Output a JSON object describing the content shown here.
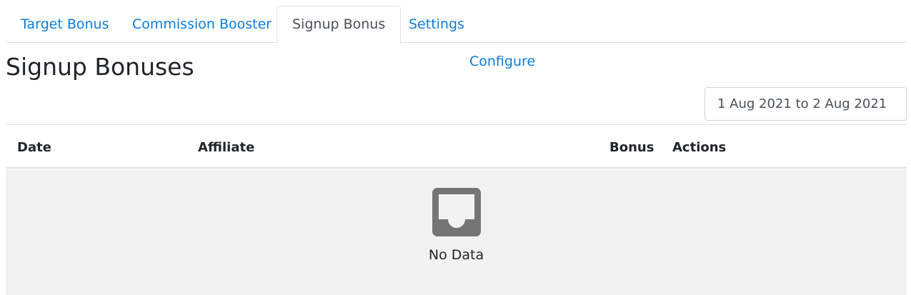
{
  "tabs": [
    {
      "label": "Target Bonus",
      "active": false
    },
    {
      "label": "Commission Booster",
      "active": false
    },
    {
      "label": "Signup Bonus",
      "active": true
    },
    {
      "label": "Settings",
      "active": false
    }
  ],
  "page": {
    "title": "Signup Bonuses",
    "configure_link": "Configure"
  },
  "filter": {
    "date_range": "1 Aug 2021 to 2 Aug 2021"
  },
  "table": {
    "columns": [
      "Date",
      "Affiliate",
      "Bonus",
      "Actions"
    ],
    "rows": [],
    "empty_text": "No Data",
    "empty_icon": "empty-inbox-icon"
  },
  "colors": {
    "link": "#0d7bdd",
    "empty_bg": "#f2f2f2",
    "icon": "#757575"
  }
}
